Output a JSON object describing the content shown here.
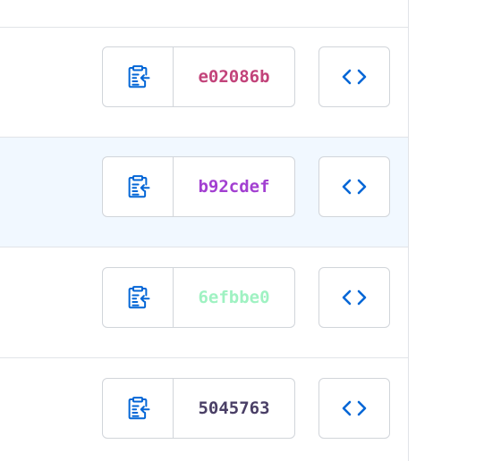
{
  "commits": [
    {
      "sha": "e02086b",
      "sha_color": "#c2437a"
    },
    {
      "sha": "b92cdef",
      "sha_color": "#a23fd1"
    },
    {
      "sha": "6efbbe0",
      "sha_color": "#9ff2c2"
    },
    {
      "sha": "5045763",
      "sha_color": "#4a3f66"
    }
  ],
  "icons": {
    "copy": "clippy-icon",
    "browse": "code-icon"
  },
  "colors": {
    "icon_blue": "#0366d6",
    "border": "#d1d5da",
    "divider": "#e1e4e8",
    "highlight_row": "#f1f8ff"
  }
}
